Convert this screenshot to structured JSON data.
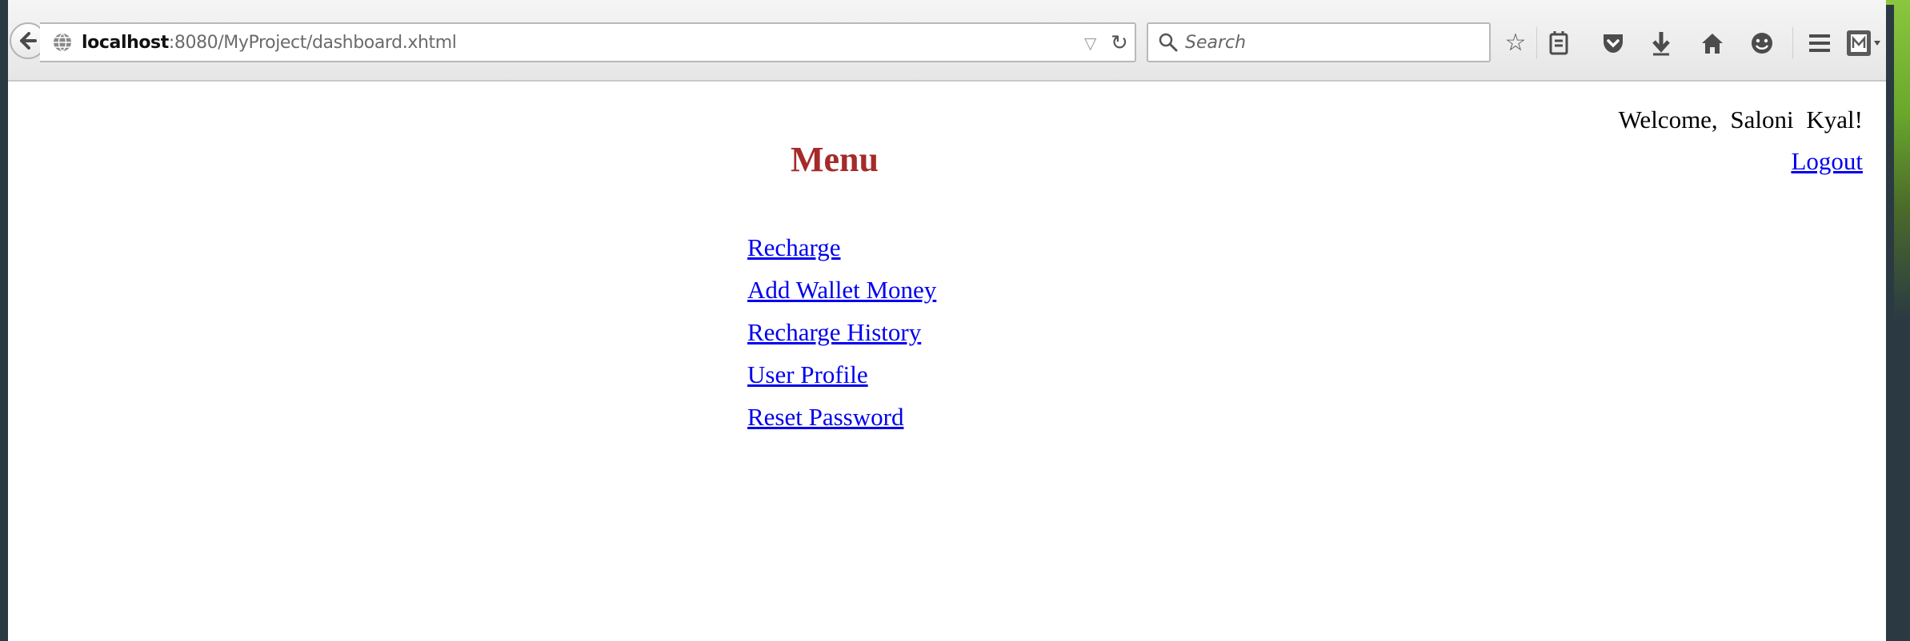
{
  "browser": {
    "url_host": "localhost",
    "url_rest": ":8080/MyProject/dashboard.xhtml",
    "search_placeholder": "Search",
    "icons": [
      "back-icon",
      "globe-icon",
      "dropmarker-icon",
      "reload-icon",
      "search-icon",
      "bookmark-star-icon",
      "reading-list-icon",
      "pocket-icon",
      "download-icon",
      "home-icon",
      "hello-chat-icon",
      "hamburger-menu-icon",
      "extension-icon"
    ]
  },
  "page": {
    "welcome_text": "Welcome, Saloni Kyal!",
    "logout_label": "Logout",
    "menu_title": "Menu",
    "menu_items": [
      {
        "label": "Recharge"
      },
      {
        "label": "Add Wallet Money"
      },
      {
        "label": "Recharge History"
      },
      {
        "label": "User Profile"
      },
      {
        "label": "Reset Password"
      }
    ],
    "colors": {
      "title": "#a52a2a",
      "link": "#0000ee",
      "background": "#2b3a42",
      "accent_green": "#8cc63f"
    }
  }
}
